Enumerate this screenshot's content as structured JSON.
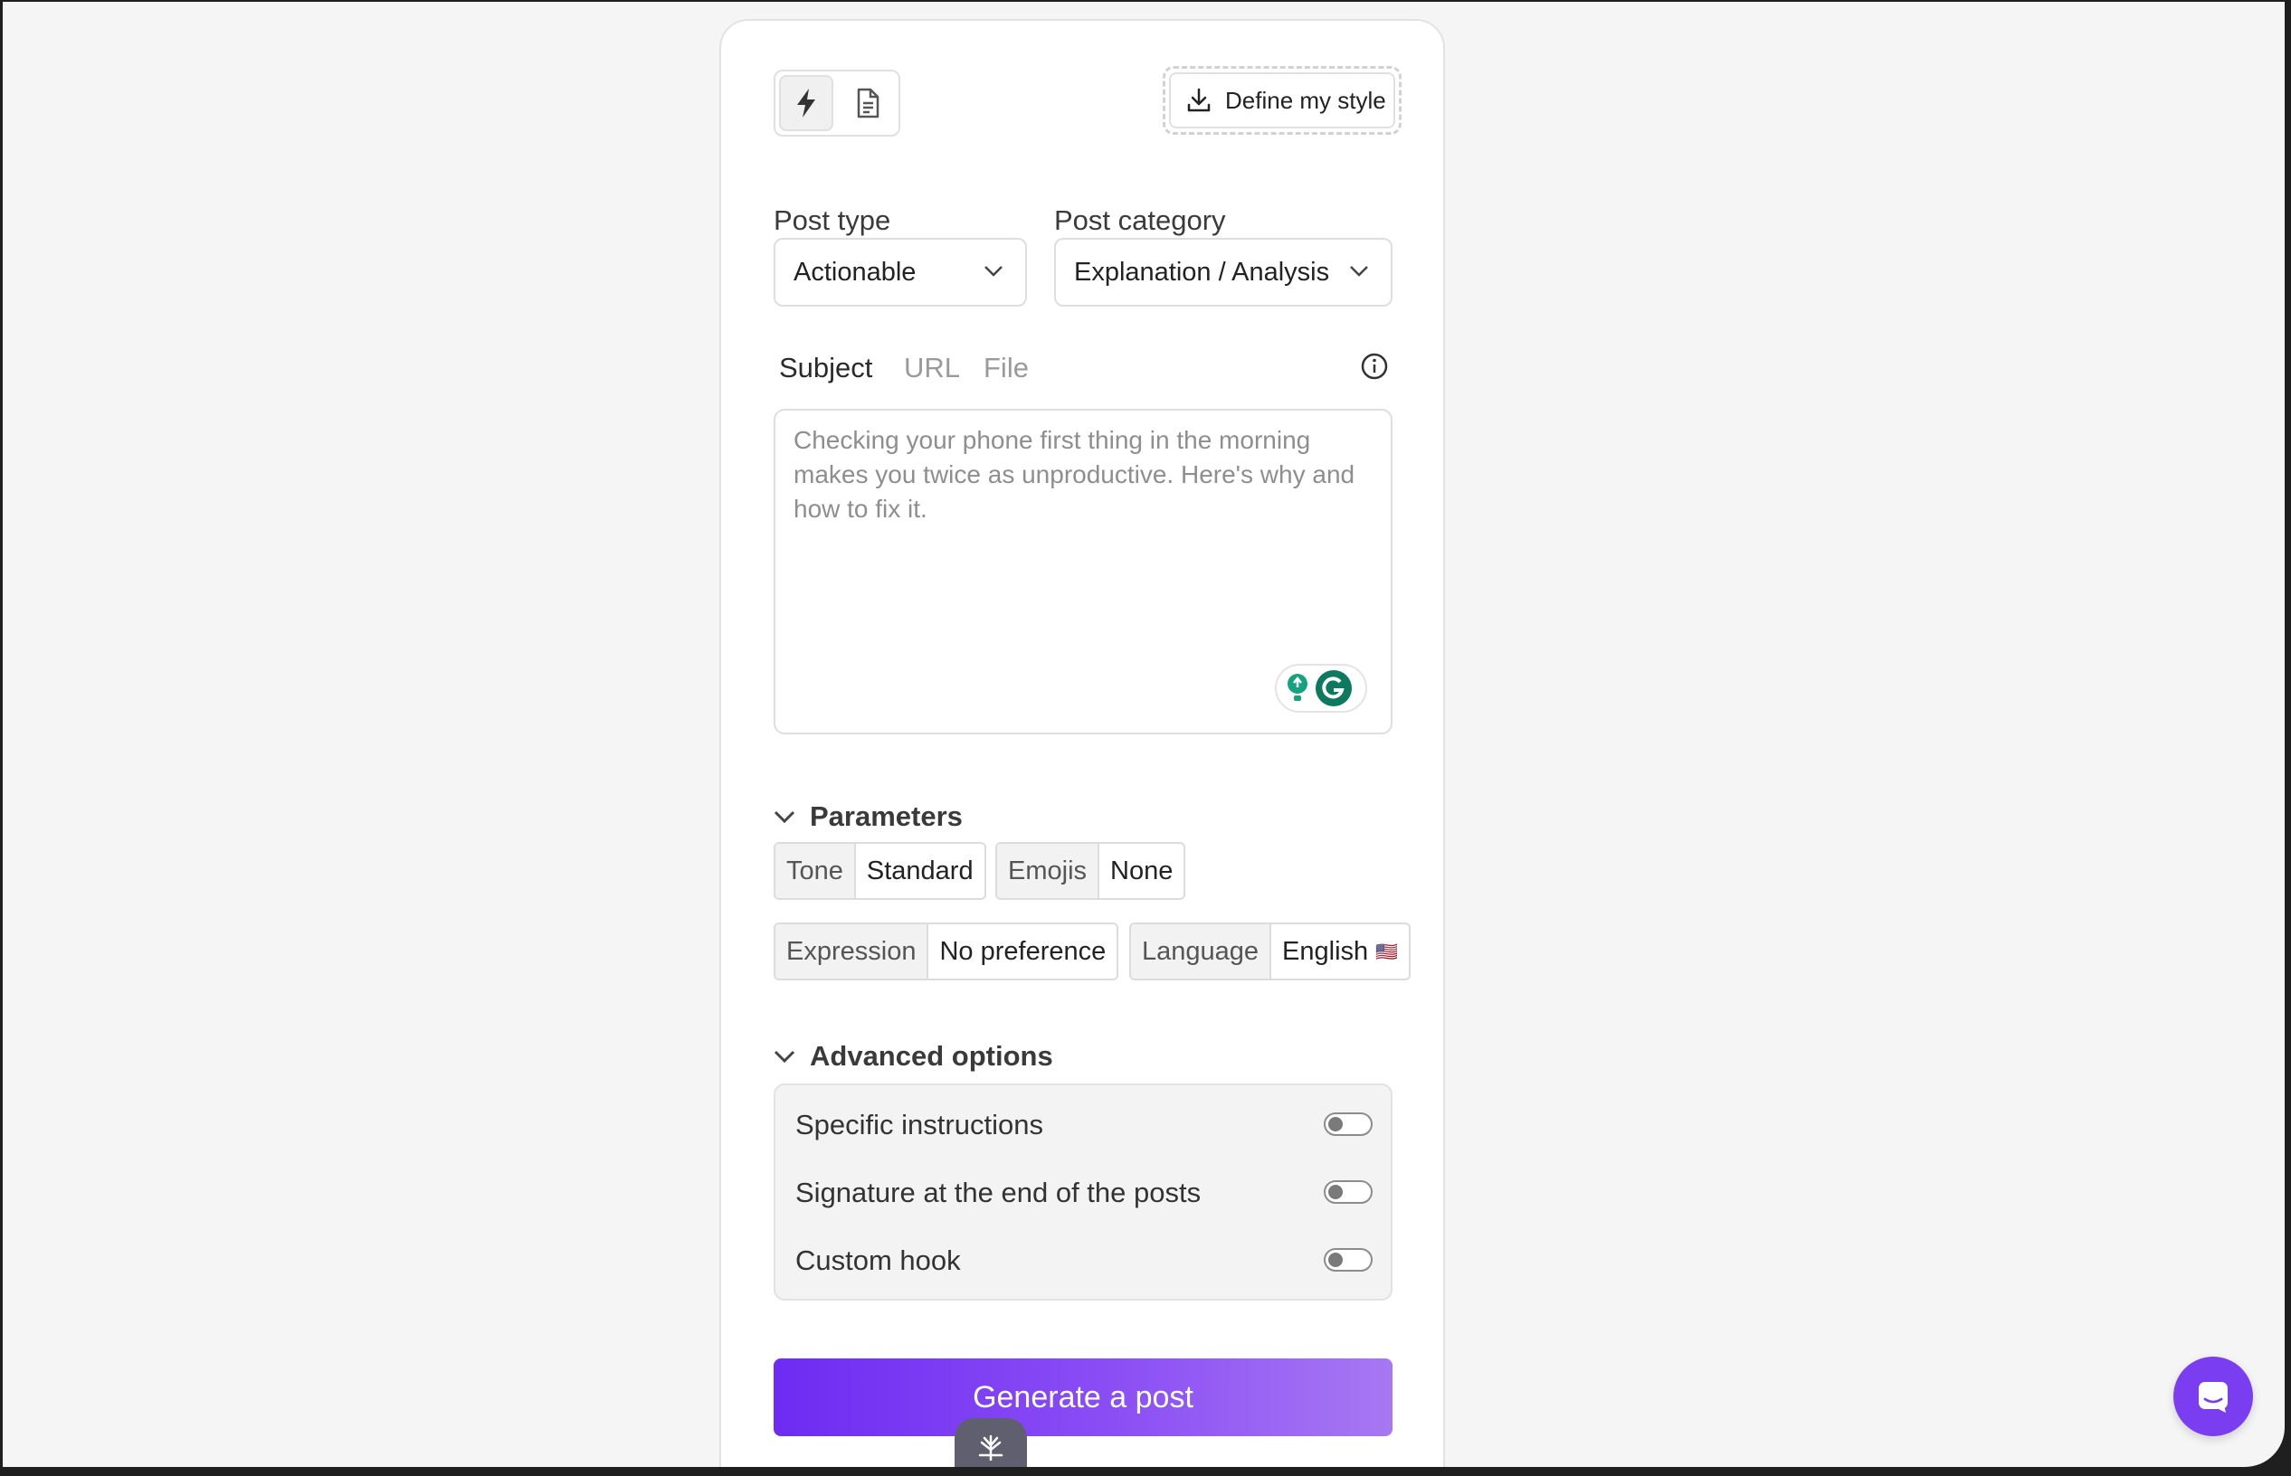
{
  "toolbar": {
    "define_style_label": "Define my style",
    "modes": [
      "bolt-icon",
      "document-icon"
    ]
  },
  "post_type": {
    "label": "Post type",
    "value": "Actionable"
  },
  "post_category": {
    "label": "Post category",
    "value": "Explanation / Analysis"
  },
  "source_tabs": [
    {
      "label": "Subject",
      "active": true
    },
    {
      "label": "URL",
      "active": false
    },
    {
      "label": "File",
      "active": false
    }
  ],
  "subject": {
    "value": "",
    "placeholder": "Checking your phone first thing in the morning makes you twice as unproductive. Here's why and how to fix it."
  },
  "parameters": {
    "title": "Parameters",
    "tone": {
      "key": "Tone",
      "value": "Standard"
    },
    "emojis": {
      "key": "Emojis",
      "value": "None"
    },
    "expression": {
      "key": "Expression",
      "value": "No preference"
    },
    "language": {
      "key": "Language",
      "value": "English",
      "flag": "🇺🇸"
    }
  },
  "advanced": {
    "title": "Advanced options",
    "options": [
      {
        "label": "Specific instructions",
        "enabled": false
      },
      {
        "label": "Signature at the end of the posts",
        "enabled": false
      },
      {
        "label": "Custom hook",
        "enabled": false
      }
    ]
  },
  "generate_label": "Generate a post",
  "colors": {
    "accent_start": "#6e2bf2",
    "accent_end": "#a778f2",
    "fab": "#7a3df0"
  }
}
